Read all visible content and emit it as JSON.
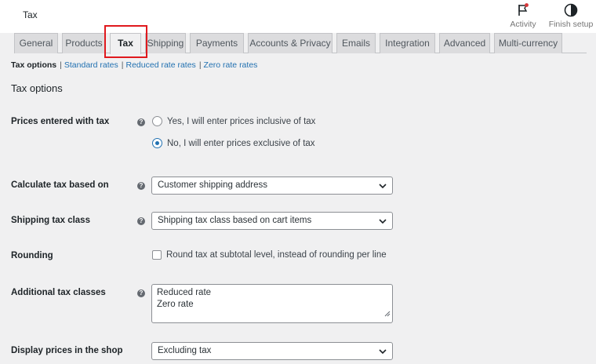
{
  "header": {
    "title": "Tax",
    "actions": [
      {
        "label": "Activity",
        "icon": "flag-icon"
      },
      {
        "label": "Finish setup",
        "icon": "half-circle-icon"
      }
    ]
  },
  "tabs": [
    {
      "label": "General"
    },
    {
      "label": "Products"
    },
    {
      "label": "Tax",
      "active": true
    },
    {
      "label": "Shipping"
    },
    {
      "label": "Payments"
    },
    {
      "label": "Accounts & Privacy"
    },
    {
      "label": "Emails"
    },
    {
      "label": "Integration"
    },
    {
      "label": "Advanced"
    },
    {
      "label": "Multi-currency"
    }
  ],
  "subnav": {
    "current": "Tax options",
    "links": [
      "Standard rates",
      "Reduced rate rates",
      "Zero rate rates"
    ],
    "separator": "|"
  },
  "section": {
    "title": "Tax options"
  },
  "fields": {
    "prices_entered": {
      "label": "Prices entered with tax",
      "options": [
        {
          "label": "Yes, I will enter prices inclusive of tax",
          "checked": false
        },
        {
          "label": "No, I will enter prices exclusive of tax",
          "checked": true
        }
      ]
    },
    "calculate_based_on": {
      "label": "Calculate tax based on",
      "value": "Customer shipping address"
    },
    "shipping_tax_class": {
      "label": "Shipping tax class",
      "value": "Shipping tax class based on cart items"
    },
    "rounding": {
      "label": "Rounding",
      "checkbox_label": "Round tax at subtotal level, instead of rounding per line",
      "checked": false
    },
    "additional_tax_classes": {
      "label": "Additional tax classes",
      "lines": [
        "Reduced rate",
        "Zero rate"
      ]
    },
    "display_prices_shop": {
      "label": "Display prices in the shop",
      "value": "Excluding tax"
    }
  },
  "colors": {
    "accent": "#2271b1",
    "highlight": "#e0191e",
    "background": "#f0f0f1"
  }
}
